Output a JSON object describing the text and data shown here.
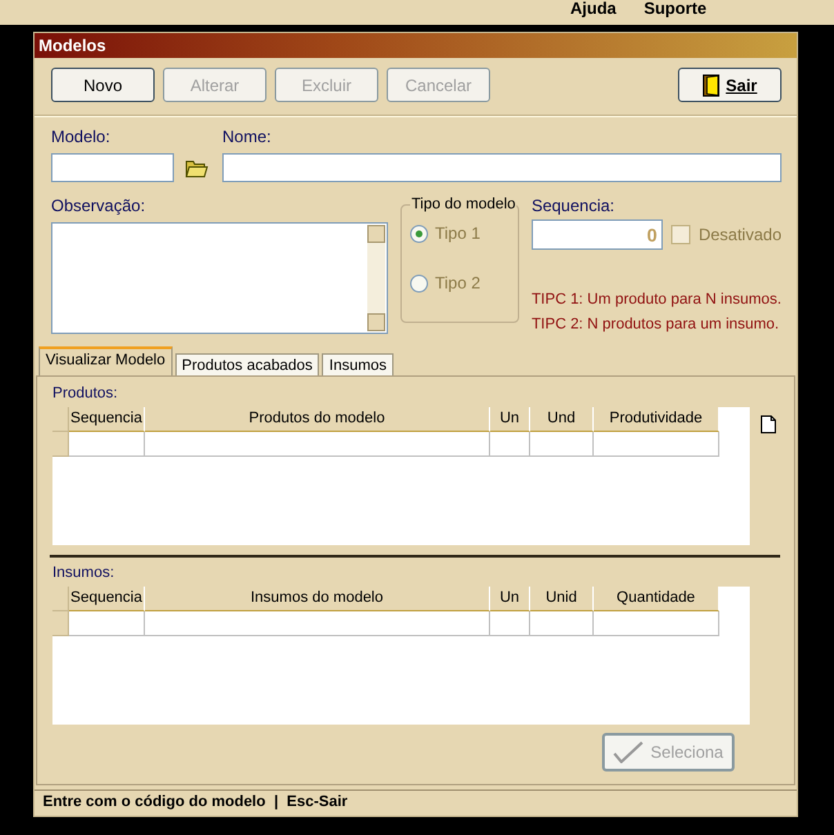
{
  "menu": [
    {
      "label": "Ajuda"
    },
    {
      "label": "Suporte"
    }
  ],
  "window": {
    "title": "Modelos"
  },
  "toolbar": [
    {
      "label": "Novo",
      "disabled": false
    },
    {
      "label": "Alterar",
      "disabled": true
    },
    {
      "label": "Excluir",
      "disabled": true
    },
    {
      "label": "Cancelar",
      "disabled": true
    }
  ],
  "exit_button": {
    "label": "Sair"
  },
  "modelo": {
    "label": "Modelo:"
  },
  "nome": {
    "label": "Nome:"
  },
  "observacao": {
    "label": "Observação:"
  },
  "tipo_do_modelo": {
    "title": "Tipo do modelo",
    "disabled": true,
    "options": [
      {
        "label": "Tipo 1",
        "selected": true
      },
      {
        "label": "Tipo 2",
        "selected": false
      }
    ]
  },
  "sequencia": {
    "label": "Sequencia:",
    "value": "0"
  },
  "desativado": {
    "label": "Desativado",
    "checked": false,
    "disabled": true
  },
  "notes": [
    "TIPC 1: Um produto para N insumos.",
    "TIPC 2: N produtos para um insumo."
  ],
  "tabs": [
    {
      "label": "Visualizar Modelo",
      "selected": true
    },
    {
      "label": "Produtos acabados",
      "selected": false
    },
    {
      "label": "Insumos",
      "selected": false
    }
  ],
  "grids": [
    {
      "title": "Produtos:",
      "columns": [
        "Sequencia",
        "Produtos do modelo",
        "Un",
        "Und",
        "Produtividade"
      ]
    },
    {
      "title": "Insumos:",
      "columns": [
        "Sequencia",
        "Insumos do modelo",
        "Un",
        "Unid",
        "Quantidade"
      ]
    }
  ],
  "select_button": {
    "label": "Seleciona",
    "disabled": true
  },
  "status_bar": "Entre com o código do modelo  |  Esc-Sair"
}
